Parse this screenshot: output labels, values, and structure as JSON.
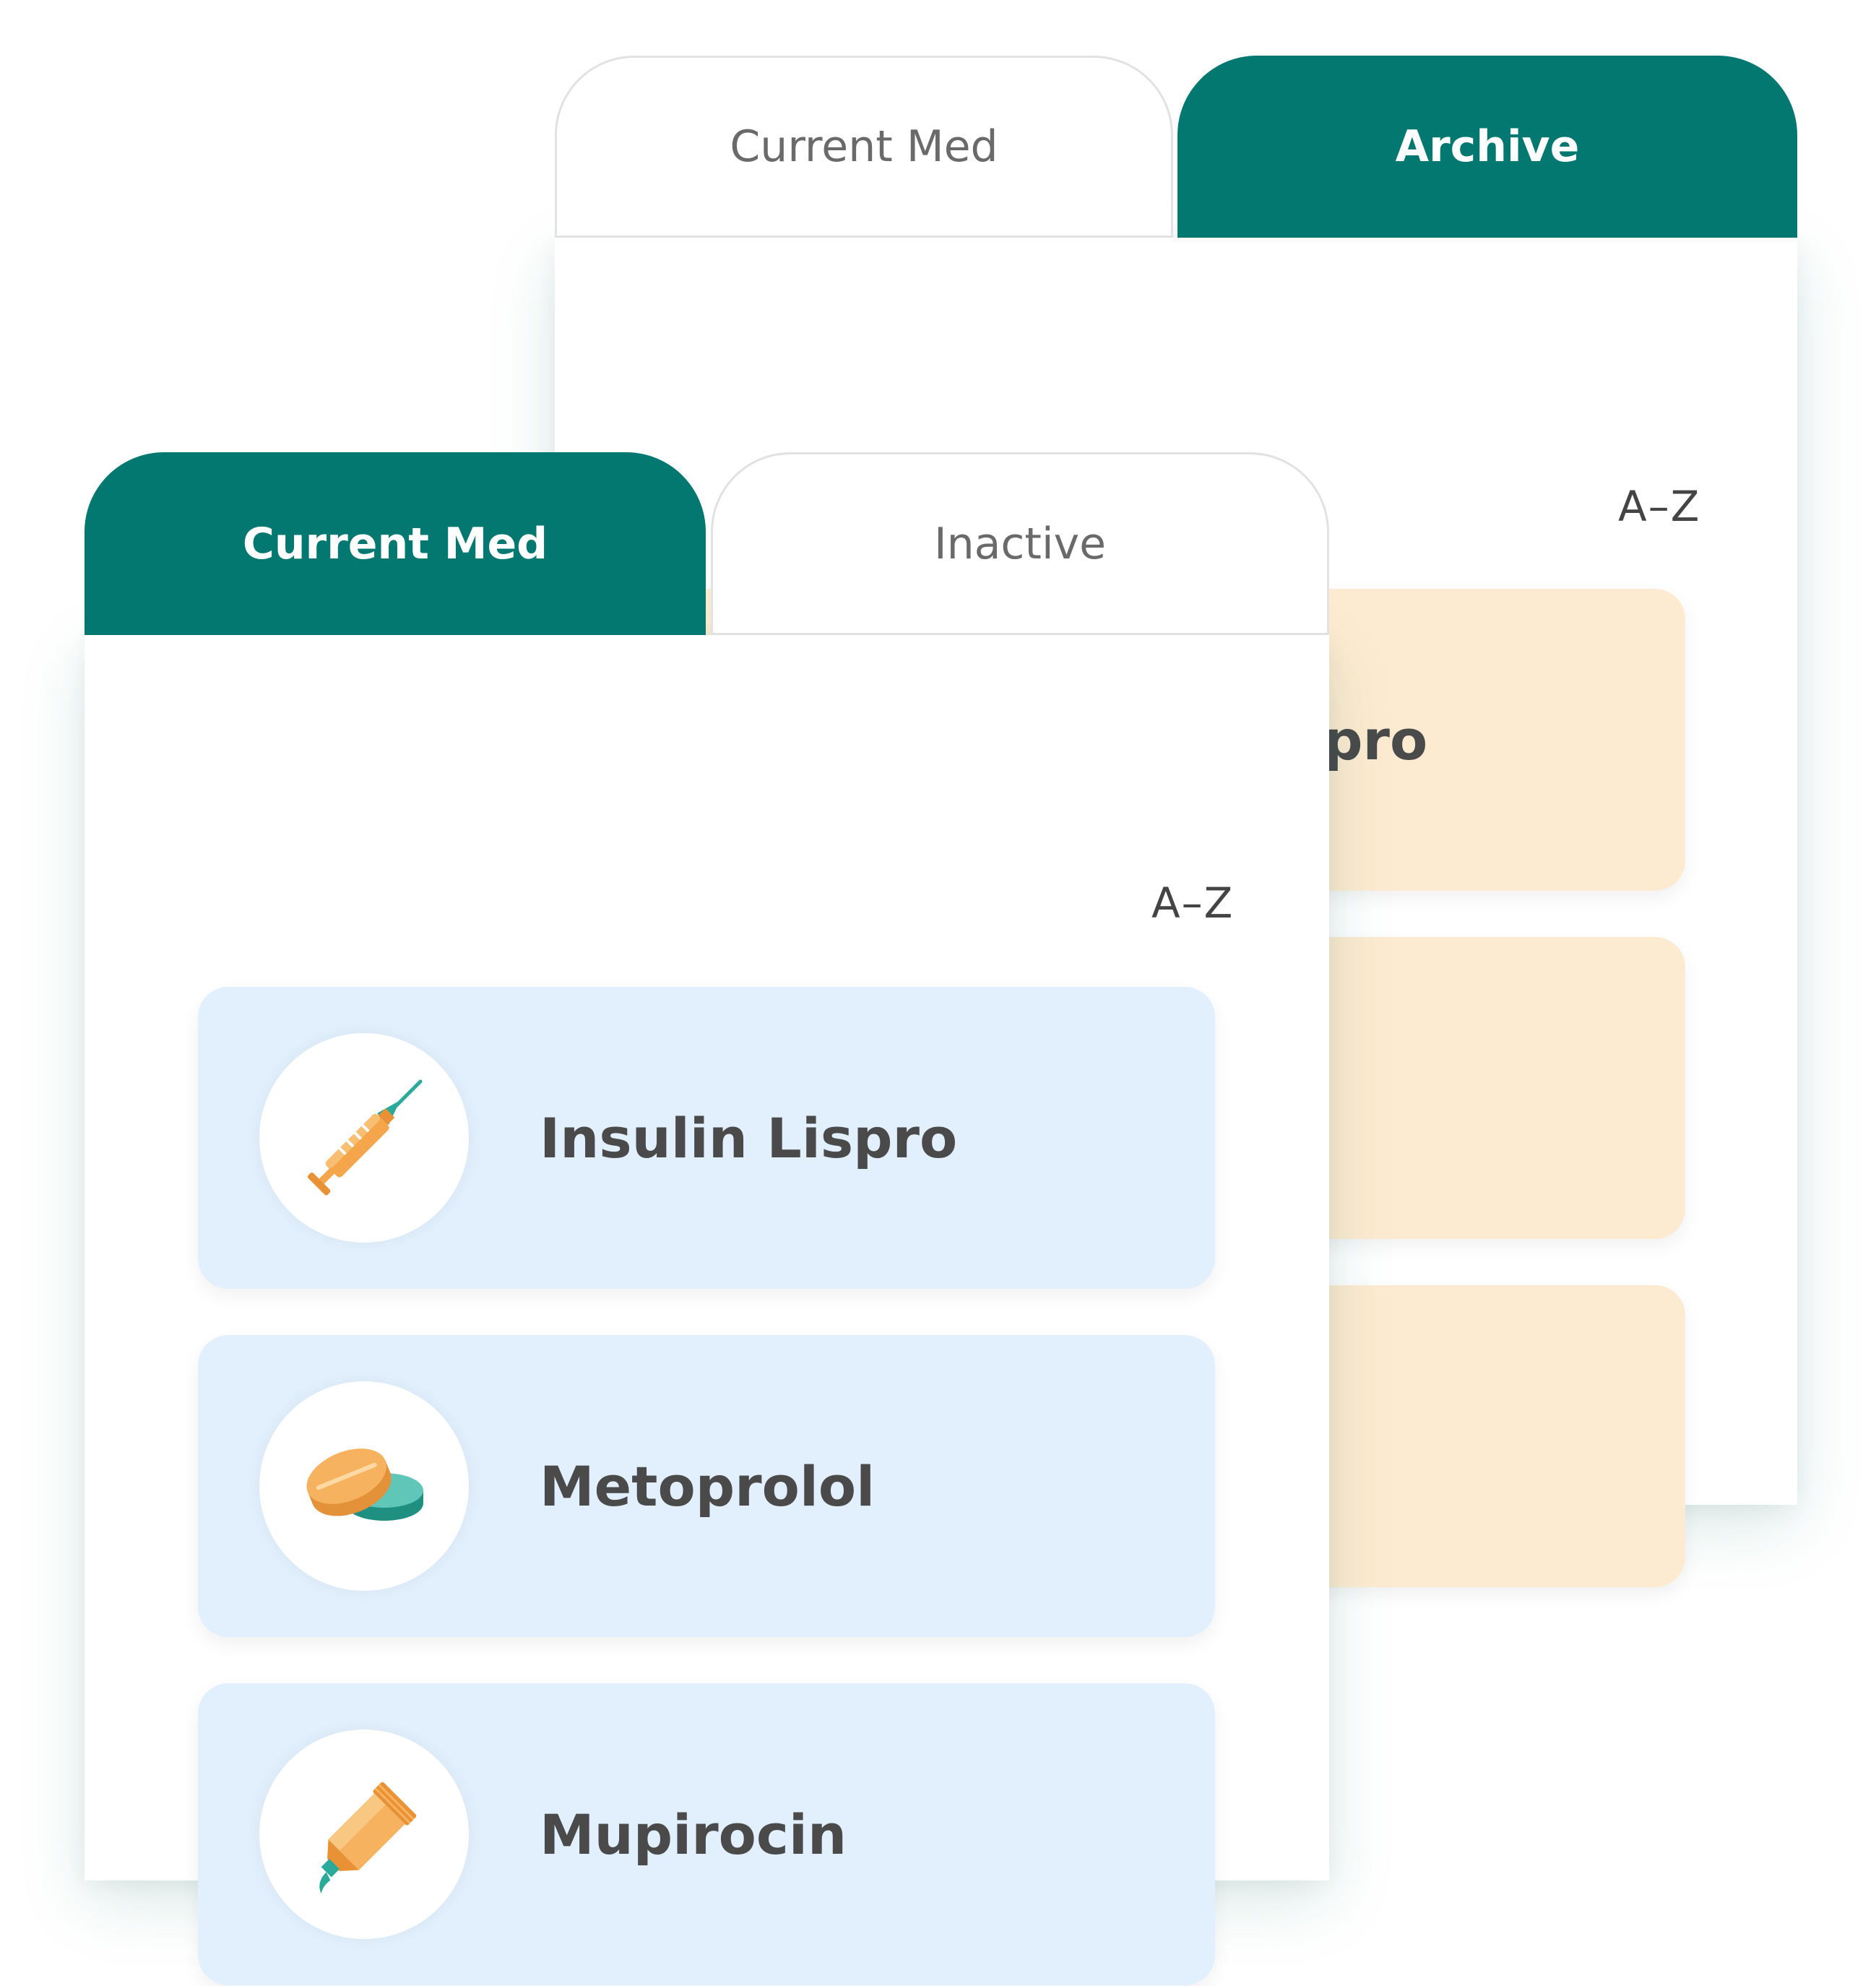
{
  "archive_panel": {
    "tabs": [
      {
        "label": "Current Med",
        "active": false
      },
      {
        "label": "Archive",
        "active": true
      }
    ],
    "sort_label": "A–Z",
    "items": [
      {
        "name": "Insulin Lispro",
        "icon": "syringe-icon"
      },
      {
        "name": "",
        "icon": ""
      },
      {
        "name": "",
        "icon": ""
      }
    ]
  },
  "current_panel": {
    "tabs": [
      {
        "label": "Current Med",
        "active": true
      },
      {
        "label": "Inactive",
        "active": false
      }
    ],
    "sort_label": "A–Z",
    "items": [
      {
        "name": "Insulin Lispro",
        "icon": "syringe-icon"
      },
      {
        "name": "Metoprolol",
        "icon": "pill-tablets-icon"
      },
      {
        "name": "Mupirocin",
        "icon": "ointment-tube-icon"
      }
    ]
  },
  "colors": {
    "accent_teal": "#037870",
    "current_card": "#e2f0fd",
    "archived_card": "#fdebd1",
    "text_dark": "#4a4a4a",
    "icon_orange": "#f5a54a",
    "icon_teal": "#2ba99a"
  }
}
